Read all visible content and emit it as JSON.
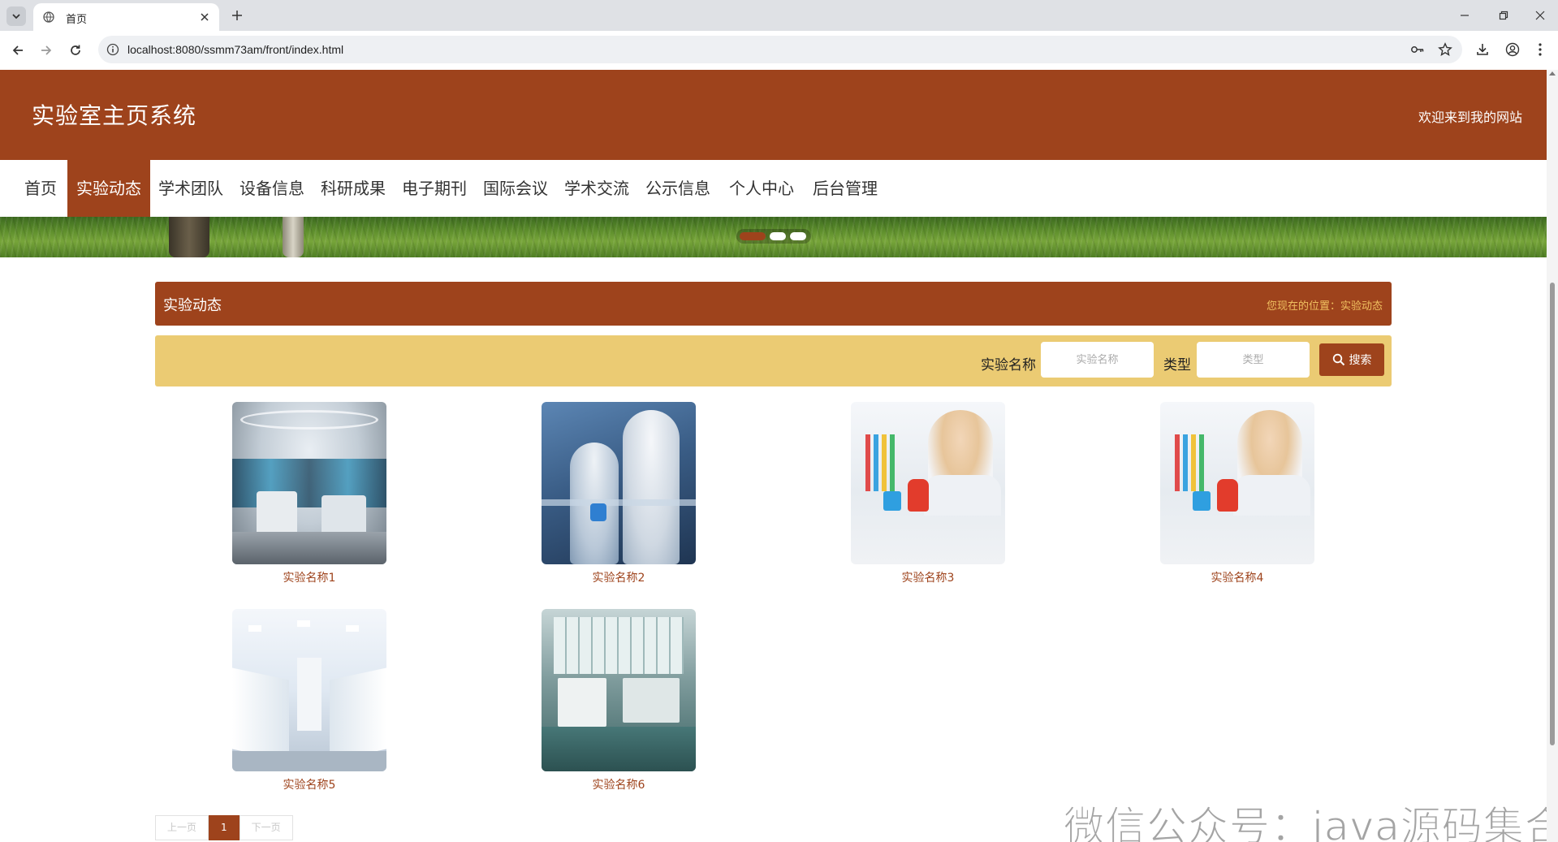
{
  "browser": {
    "tab_title": "首页",
    "url": "localhost:8080/ssmm73am/front/index.html"
  },
  "header": {
    "site_title": "实验室主页系统",
    "welcome": "欢迎来到我的网站"
  },
  "nav": {
    "items": [
      "首页",
      "实验动态",
      "学术团队",
      "设备信息",
      "科研成果",
      "电子期刊",
      "国际会议",
      "学术交流",
      "公示信息",
      "个人中心",
      "后台管理"
    ],
    "active": "实验动态"
  },
  "crumb": {
    "title": "实验动态",
    "location": "您现在的位置：实验动态"
  },
  "search": {
    "name_label": "实验名称",
    "name_placeholder": "实验名称",
    "type_label": "类型",
    "type_placeholder": "类型",
    "button_label": "搜索"
  },
  "items": [
    {
      "name": "实验名称1"
    },
    {
      "name": "实验名称2"
    },
    {
      "name": "实验名称3"
    },
    {
      "name": "实验名称4"
    },
    {
      "name": "实验名称5"
    },
    {
      "name": "实验名称6"
    }
  ],
  "pager": {
    "prev": "上一页",
    "current": "1",
    "next": "下一页"
  },
  "watermark": "微信公众号：java源码集合",
  "colors": {
    "brand": "#9e431c",
    "search_bg": "#ebcb73",
    "crumb_location": "#f0c060"
  }
}
